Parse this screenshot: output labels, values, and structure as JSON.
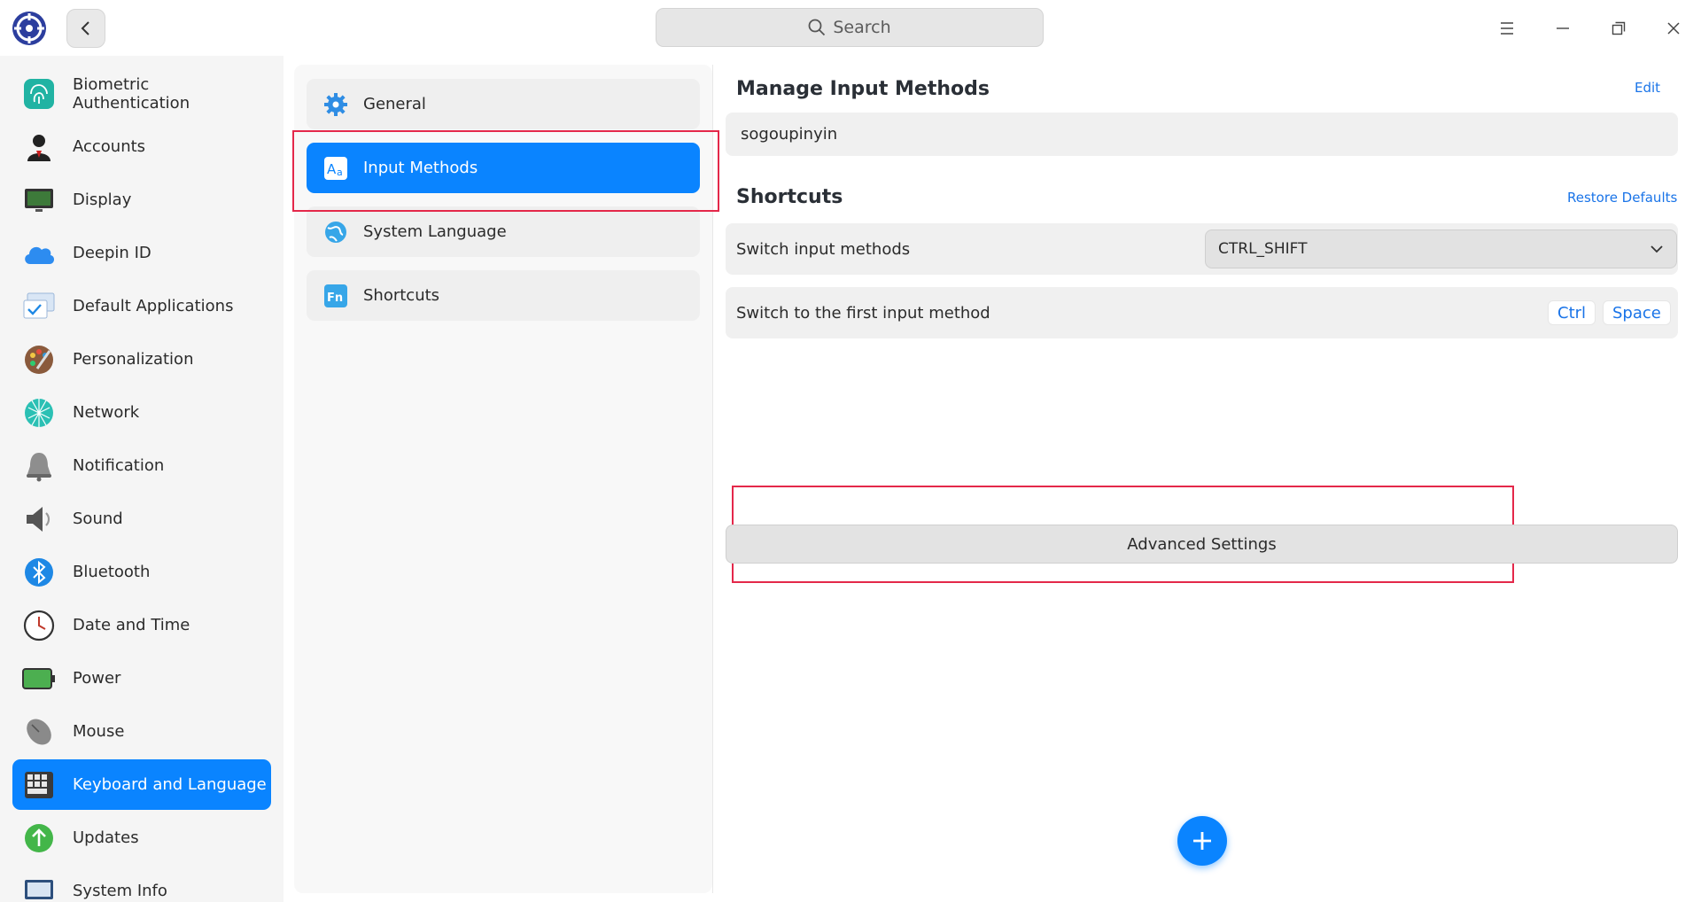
{
  "titlebar": {
    "search_placeholder": "Search"
  },
  "sidebar": {
    "items": [
      {
        "label": "Biometric Authentication",
        "icon": "fingerprint-icon"
      },
      {
        "label": "Accounts",
        "icon": "accounts-icon"
      },
      {
        "label": "Display",
        "icon": "display-icon"
      },
      {
        "label": "Deepin ID",
        "icon": "cloud-icon"
      },
      {
        "label": "Default Applications",
        "icon": "default-apps-icon"
      },
      {
        "label": "Personalization",
        "icon": "palette-icon"
      },
      {
        "label": "Network",
        "icon": "network-icon"
      },
      {
        "label": "Notification",
        "icon": "bell-icon"
      },
      {
        "label": "Sound",
        "icon": "speaker-icon"
      },
      {
        "label": "Bluetooth",
        "icon": "bluetooth-icon"
      },
      {
        "label": "Date and Time",
        "icon": "clock-icon"
      },
      {
        "label": "Power",
        "icon": "battery-icon"
      },
      {
        "label": "Mouse",
        "icon": "mouse-icon"
      },
      {
        "label": "Keyboard and Language",
        "icon": "keyboard-icon",
        "active": true
      },
      {
        "label": "Updates",
        "icon": "update-icon"
      },
      {
        "label": "System Info",
        "icon": "system-info-icon"
      }
    ]
  },
  "middle": {
    "items": [
      {
        "label": "General",
        "icon": "gear-icon"
      },
      {
        "label": "Input Methods",
        "icon": "input-method-icon",
        "active": true
      },
      {
        "label": "System Language",
        "icon": "globe-icon"
      },
      {
        "label": "Shortcuts",
        "icon": "fn-key-icon"
      }
    ]
  },
  "content": {
    "manage_title": "Manage Input Methods",
    "edit_label": "Edit",
    "input_method": "sogoupinyin",
    "shortcuts_title": "Shortcuts",
    "restore_label": "Restore Defaults",
    "switch_label": "Switch input methods",
    "switch_value": "CTRL_SHIFT",
    "first_label": "Switch to the first input method",
    "key1": "Ctrl",
    "key2": "Space",
    "advanced_label": "Advanced Settings"
  },
  "colors": {
    "accent": "#0a84ff",
    "highlight": "#e4284a"
  }
}
